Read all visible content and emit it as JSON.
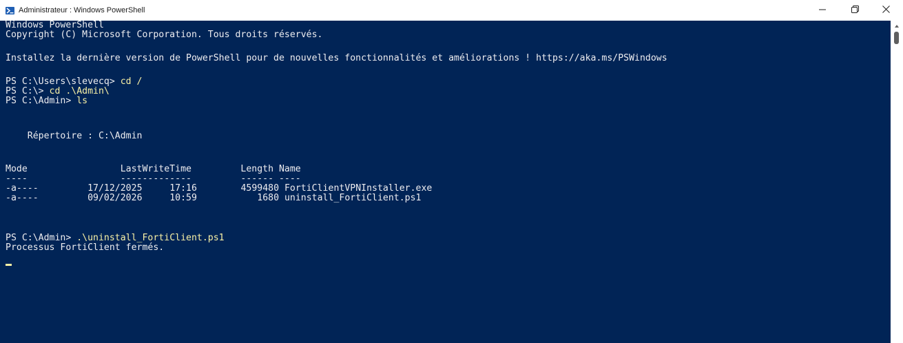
{
  "window": {
    "title": "Administrateur : Windows PowerShell",
    "icon": "powershell-icon",
    "controls": {
      "minimize": "—",
      "maximize": "❐",
      "close": "✕"
    }
  },
  "colors": {
    "console_bg": "#012456",
    "text": "#eeedf0",
    "command": "#f9f1a5"
  },
  "console": {
    "header_line1": "Windows PowerShell",
    "header_line2": "Copyright (C) Microsoft Corporation. Tous droits réservés.",
    "update_notice": "Installez la dernière version de PowerShell pour de nouvelles fonctionnalités et améliorations ! https://aka.ms/PSWindows",
    "commands": [
      {
        "prompt": "PS C:\\Users\\slevecq> ",
        "command": "cd /"
      },
      {
        "prompt": "PS C:\\> ",
        "command": "cd .\\Admin\\"
      },
      {
        "prompt": "PS C:\\Admin> ",
        "command": "ls"
      }
    ],
    "directory_line": "    Répertoire : C:\\Admin",
    "table_header": "Mode                 LastWriteTime         Length Name",
    "table_separator": "----                 -------------         ------ ----",
    "rows": [
      {
        "mode": "-a----",
        "date": "17/12/2025",
        "time": "17:16",
        "length": "4599480",
        "name": "FortiClientVPNInstaller.exe"
      },
      {
        "mode": "-a----",
        "date": "09/02/2026",
        "time": "10:59",
        "length": "1680",
        "name": "uninstall_FortiClient.ps1"
      }
    ],
    "last_command": {
      "prompt": "PS C:\\Admin> ",
      "command": ".\\uninstall_FortiClient.ps1"
    },
    "output": "Processus FortiClient fermés."
  }
}
